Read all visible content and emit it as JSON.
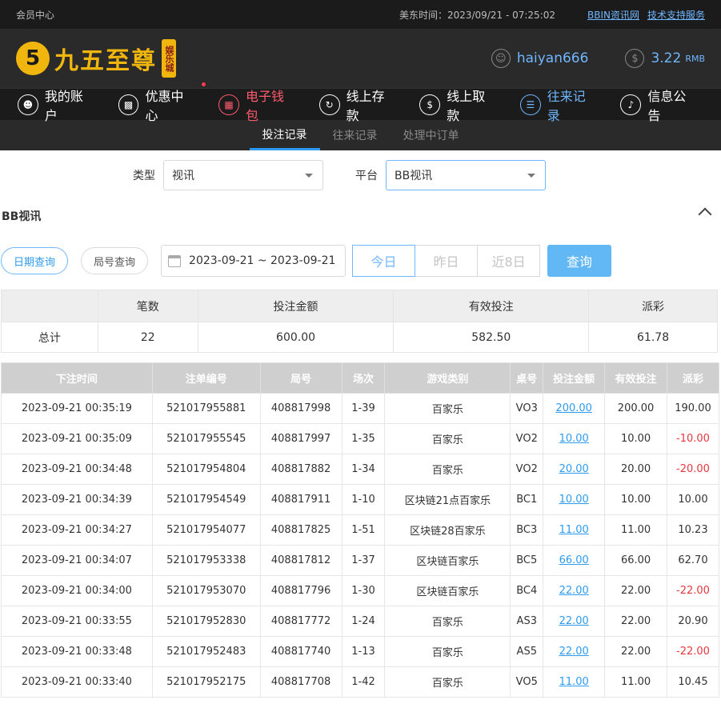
{
  "topbar": {
    "left": "会员中心",
    "time": "美东时间：2023/09/21 - 07:25:02",
    "link1": "BBIN资讯网",
    "link2": "技术支持服务"
  },
  "header": {
    "logo_mark": "5",
    "logo_text": "九五至尊",
    "logo_badge": "娱乐城",
    "username": "haiyan666",
    "balance": "3.22",
    "currency": "RMB"
  },
  "nav": [
    {
      "label": "我的账户",
      "icon": "user-icon"
    },
    {
      "label": "优惠中心",
      "icon": "gift-icon"
    },
    {
      "label": "电子钱包",
      "icon": "wallet-icon"
    },
    {
      "label": "线上存款",
      "icon": "deposit-icon"
    },
    {
      "label": "线上取款",
      "icon": "withdraw-icon"
    },
    {
      "label": "往来记录",
      "icon": "records-icon"
    },
    {
      "label": "信息公告",
      "icon": "bell-icon"
    }
  ],
  "subtabs": [
    "投注记录",
    "往来记录",
    "处理中订单"
  ],
  "filters": {
    "type_label": "类型",
    "type_value": "视讯",
    "platform_label": "平台",
    "platform_value": "BB视讯"
  },
  "section_title": "BB视讯",
  "query": {
    "date_query": "日期查询",
    "round_query": "局号查询",
    "date_range": "2023-09-21 ~ 2023-09-21",
    "today": "今日",
    "yesterday": "昨日",
    "last8": "近8日",
    "search": "查询"
  },
  "summary": {
    "headers": [
      "",
      "笔数",
      "投注金额",
      "有效投注",
      "派彩"
    ],
    "row": [
      "总计",
      "22",
      "600.00",
      "582.50",
      "61.78"
    ]
  },
  "detail": {
    "headers": [
      "下注时间",
      "注单编号",
      "局号",
      "场次",
      "游戏类别",
      "桌号",
      "投注金额",
      "有效投注",
      "派彩"
    ],
    "rows": [
      [
        "2023-09-21 00:35:19",
        "521017955881",
        "408817998",
        "1-39",
        "百家乐",
        "VO3",
        "200.00",
        "200.00",
        "190.00"
      ],
      [
        "2023-09-21 00:35:09",
        "521017955545",
        "408817997",
        "1-35",
        "百家乐",
        "VO2",
        "10.00",
        "10.00",
        "-10.00"
      ],
      [
        "2023-09-21 00:34:48",
        "521017954804",
        "408817882",
        "1-34",
        "百家乐",
        "VO2",
        "20.00",
        "20.00",
        "-20.00"
      ],
      [
        "2023-09-21 00:34:39",
        "521017954549",
        "408817911",
        "1-10",
        "区块链21点百家乐",
        "BC1",
        "10.00",
        "10.00",
        "10.00"
      ],
      [
        "2023-09-21 00:34:27",
        "521017954077",
        "408817825",
        "1-51",
        "区块链28百家乐",
        "BC3",
        "11.00",
        "11.00",
        "10.23"
      ],
      [
        "2023-09-21 00:34:07",
        "521017953338",
        "408817812",
        "1-37",
        "区块链百家乐",
        "BC5",
        "66.00",
        "66.00",
        "62.70"
      ],
      [
        "2023-09-21 00:34:00",
        "521017953070",
        "408817796",
        "1-30",
        "区块链百家乐",
        "BC4",
        "22.00",
        "22.00",
        "-22.00"
      ],
      [
        "2023-09-21 00:33:55",
        "521017952830",
        "408817772",
        "1-24",
        "百家乐",
        "AS3",
        "22.00",
        "22.00",
        "20.90"
      ],
      [
        "2023-09-21 00:33:48",
        "521017952483",
        "408817740",
        "1-13",
        "百家乐",
        "AS5",
        "22.00",
        "22.00",
        "-22.00"
      ],
      [
        "2023-09-21 00:33:40",
        "521017952175",
        "408817708",
        "1-42",
        "百家乐",
        "VO5",
        "11.00",
        "11.00",
        "10.45"
      ]
    ]
  }
}
